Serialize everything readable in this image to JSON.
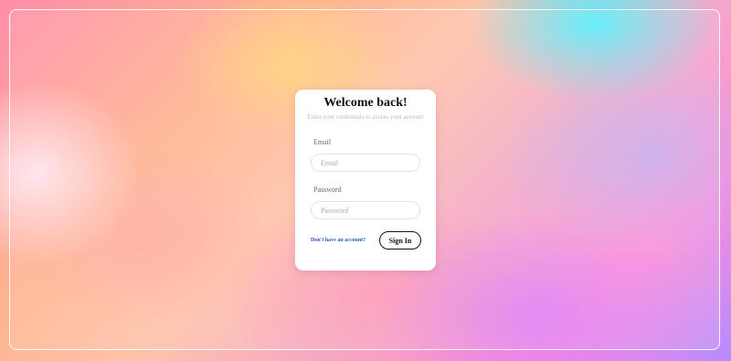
{
  "login": {
    "title": "Welcome back!",
    "subtitle": "Enter your credentials to access your account",
    "email": {
      "label": "Email",
      "placeholder": "Email",
      "value": ""
    },
    "password": {
      "label": "Password",
      "placeholder": "Password",
      "value": ""
    },
    "signup_link": "Don't have an account?",
    "submit_label": "Sign In"
  },
  "colors": {
    "card_background": "#ffffff",
    "link_color": "#2a5dbb",
    "button_border": "#111111",
    "frame_border": "#ffffff"
  }
}
